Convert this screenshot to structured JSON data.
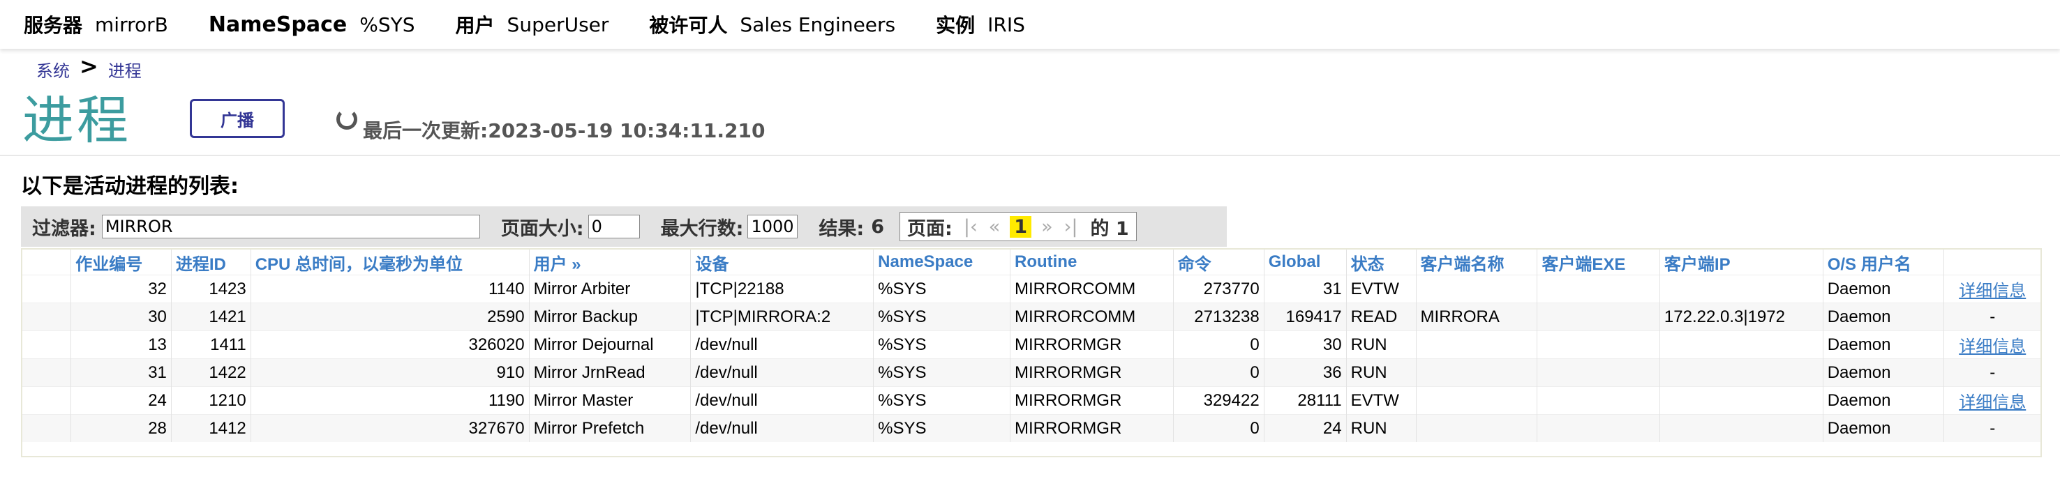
{
  "header": {
    "server_label": "服务器",
    "server_value": "mirrorB",
    "namespace_label": "NameSpace",
    "namespace_value": "%SYS",
    "user_label": "用户",
    "user_value": "SuperUser",
    "licensee_label": "被许可人",
    "licensee_value": "Sales Engineers",
    "instance_label": "实例",
    "instance_value": "IRIS"
  },
  "breadcrumb": {
    "items": [
      "系统",
      "进程"
    ],
    "separator": ">"
  },
  "page_title": "进程",
  "broadcast_button": "广播",
  "last_update": "最后一次更新:2023-05-19 10:34:11.210",
  "list_title": "以下是活动进程的列表:",
  "filter": {
    "filter_label": "过滤器:",
    "filter_value": "MIRROR",
    "page_size_label": "页面大小:",
    "page_size_value": "0",
    "max_rows_label": "最大行数:",
    "max_rows_value": "1000",
    "results_label": "结果:",
    "results_value": "6",
    "page_label": "页面:",
    "first": "|‹",
    "prev": "«",
    "current_page": "1",
    "next": "»",
    "last": "›|",
    "of_label": "的 1"
  },
  "table": {
    "columns": [
      "作业编号",
      "进程ID",
      "CPU 总时间，以毫秒为单位",
      "用户 »",
      "设备",
      "NameSpace",
      "Routine",
      "命令",
      "Global",
      "状态",
      "客户端名称",
      "客户端EXE",
      "客户端IP",
      "O/S 用户名"
    ],
    "rows": [
      {
        "job": "32",
        "pid": "1423",
        "cpu": "1140",
        "user": "Mirror Arbiter",
        "device": "|TCP|22188",
        "ns": "%SYS",
        "routine": "MIRRORCOMM",
        "cmd": "273770",
        "global": "31",
        "state": "EVTW",
        "client": "",
        "exe": "",
        "ip": "",
        "osuser": "Daemon",
        "details": "详细信息"
      },
      {
        "job": "30",
        "pid": "1421",
        "cpu": "2590",
        "user": "Mirror Backup",
        "device": "|TCP|MIRRORA:2",
        "ns": "%SYS",
        "routine": "MIRRORCOMM",
        "cmd": "2713238",
        "global": "169417",
        "state": "READ",
        "client": "MIRRORA",
        "exe": "",
        "ip": "172.22.0.3|1972",
        "osuser": "Daemon",
        "details": "-"
      },
      {
        "job": "13",
        "pid": "1411",
        "cpu": "326020",
        "user": "Mirror Dejournal",
        "device": "/dev/null",
        "ns": "%SYS",
        "routine": "MIRRORMGR",
        "cmd": "0",
        "global": "30",
        "state": "RUN",
        "client": "",
        "exe": "",
        "ip": "",
        "osuser": "Daemon",
        "details": "详细信息"
      },
      {
        "job": "31",
        "pid": "1422",
        "cpu": "910",
        "user": "Mirror JrnRead",
        "device": "/dev/null",
        "ns": "%SYS",
        "routine": "MIRRORMGR",
        "cmd": "0",
        "global": "36",
        "state": "RUN",
        "client": "",
        "exe": "",
        "ip": "",
        "osuser": "Daemon",
        "details": "-"
      },
      {
        "job": "24",
        "pid": "1210",
        "cpu": "1190",
        "user": "Mirror Master",
        "device": "/dev/null",
        "ns": "%SYS",
        "routine": "MIRRORMGR",
        "cmd": "329422",
        "global": "28111",
        "state": "EVTW",
        "client": "",
        "exe": "",
        "ip": "",
        "osuser": "Daemon",
        "details": "详细信息"
      },
      {
        "job": "28",
        "pid": "1412",
        "cpu": "327670",
        "user": "Mirror Prefetch",
        "device": "/dev/null",
        "ns": "%SYS",
        "routine": "MIRRORMGR",
        "cmd": "0",
        "global": "24",
        "state": "RUN",
        "client": "",
        "exe": "",
        "ip": "",
        "osuser": "Daemon",
        "details": "-"
      }
    ]
  },
  "colors": {
    "accent_title": "#3c9c9f",
    "link": "#3a7cc5",
    "button_border": "#333695",
    "page_highlight": "#ffea00"
  }
}
